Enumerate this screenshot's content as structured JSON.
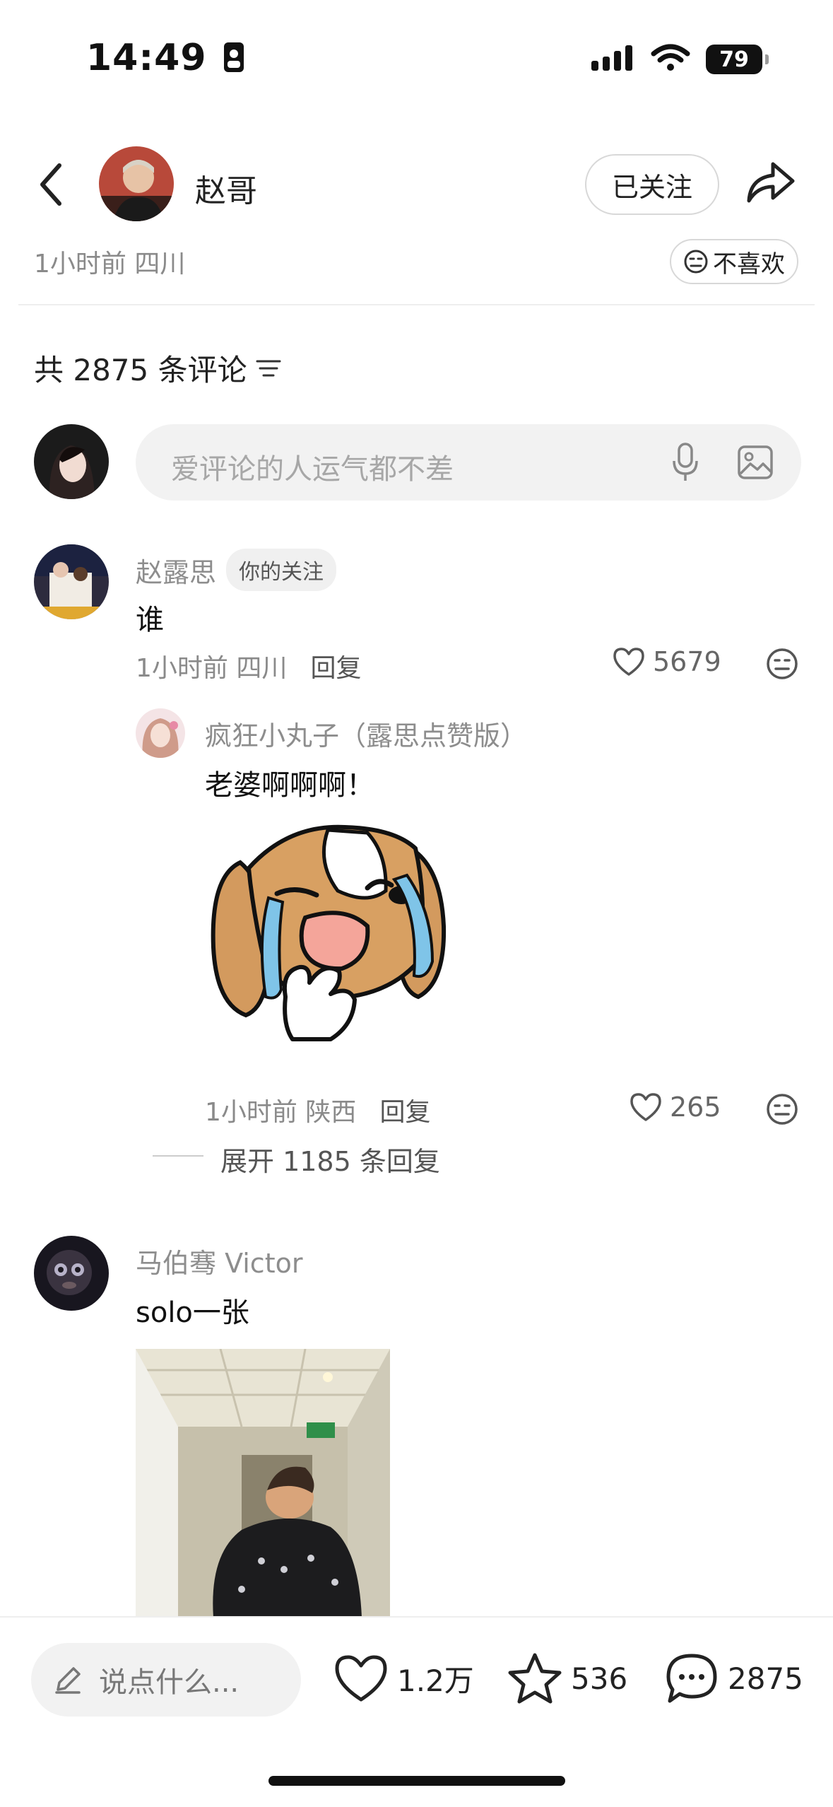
{
  "status_bar": {
    "time": "14:49",
    "battery": "79"
  },
  "header": {
    "author_name": "赵哥",
    "follow_label": "已关注",
    "post_meta": "1小时前 四川",
    "dislike_label": "不喜欢"
  },
  "comments_header": {
    "title": "共 2875 条评论"
  },
  "input": {
    "placeholder": "爱评论的人运气都不差"
  },
  "comments": [
    {
      "user": "赵露思",
      "badge": "你的关注",
      "text": "谁",
      "meta": "1小时前 四川",
      "reply": "回复",
      "likes": "5679",
      "sub_reply": {
        "user": "疯狂小丸子（露思点赞版）",
        "text": "老婆啊啊啊！",
        "meta": "1小时前 陕西",
        "reply": "回复",
        "likes": "265"
      },
      "expand": "展开 1185 条回复"
    },
    {
      "user": "马伯骞 Victor",
      "text": "solo一张"
    }
  ],
  "bottom_bar": {
    "comment_placeholder": "说点什么...",
    "likes": "1.2万",
    "favorites": "536",
    "comments": "2875"
  },
  "colors": {
    "accent_gray": "#8a8a8a",
    "divider": "#eeeeee",
    "input_bg": "#f2f2f2"
  }
}
